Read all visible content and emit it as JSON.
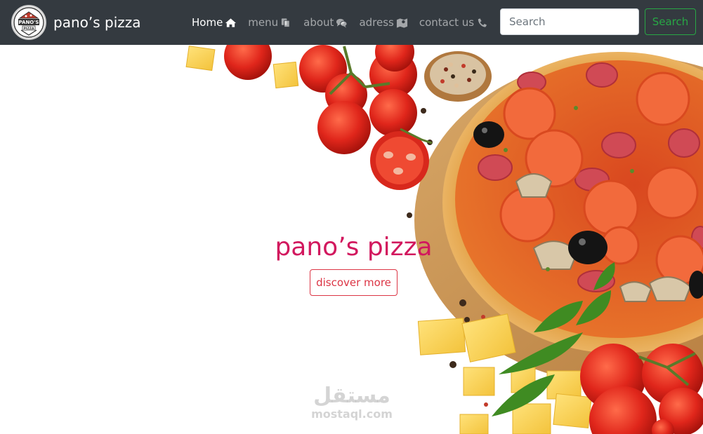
{
  "navbar": {
    "brand": "pano’s pizza",
    "logo_text": "PANO'S",
    "logo_subtext": "PIZZA",
    "items": [
      {
        "label": "Home",
        "icon": "home-icon",
        "active": true
      },
      {
        "label": "menu",
        "icon": "copy-icon",
        "active": false
      },
      {
        "label": "about",
        "icon": "comments-icon",
        "active": false
      },
      {
        "label": "adress",
        "icon": "map-icon",
        "active": false
      },
      {
        "label": "contact us",
        "icon": "phone-icon",
        "active": false
      }
    ],
    "search_placeholder": "Search",
    "search_button": "Search"
  },
  "hero": {
    "title": "pano’s pizza",
    "button": "discover more"
  },
  "watermark": {
    "arabic": "مستقل",
    "latin": "mostaql.com"
  },
  "colors": {
    "navbar_bg": "#343a40",
    "title": "#d2185e",
    "discover_border": "#dc3545",
    "search_button": "#28a745"
  }
}
